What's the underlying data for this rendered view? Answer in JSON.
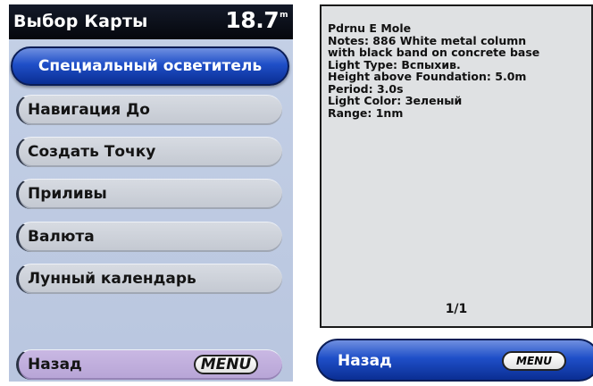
{
  "left": {
    "title": "Выбор Карты",
    "depth_value": "18.7",
    "depth_unit": "m",
    "menu": [
      {
        "label": "Специальный осветитель",
        "selected": true
      },
      {
        "label": "Навигация До",
        "selected": false
      },
      {
        "label": "Создать Точку",
        "selected": false
      },
      {
        "label": "Приливы",
        "selected": false
      },
      {
        "label": "Валюта",
        "selected": false
      },
      {
        "label": "Лунный календарь",
        "selected": false
      }
    ],
    "back_label": "Назад",
    "menu_button": "MENU"
  },
  "right": {
    "lines": [
      "Pdrnu E Mole",
      "Notes: 886 White metal column",
      "with black band on concrete base",
      "Light Type: Вспыхив.",
      "Height above Foundation: 5.0m",
      "Period: 3.0s",
      "Light Color: Зеленый",
      "Range: 1nm"
    ],
    "page_indicator": "1/1",
    "back_label": "Назад",
    "menu_button": "MENU"
  },
  "colors": {
    "selected_blue": "#1f4fc8",
    "left_background": "#bfcbe3",
    "back_item_lavender": "#c1afdd"
  }
}
